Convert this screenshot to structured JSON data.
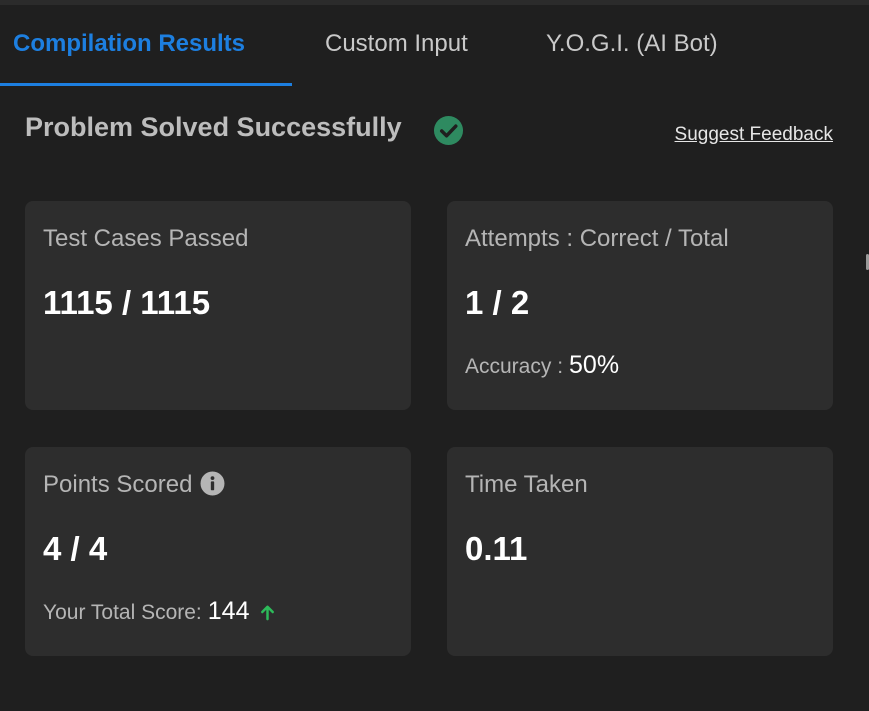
{
  "tabs": [
    {
      "label": "Compilation Results",
      "active": true
    },
    {
      "label": "Custom Input",
      "active": false
    },
    {
      "label": "Y.O.G.I. (AI Bot)",
      "active": false
    }
  ],
  "status": {
    "title": "Problem Solved Successfully",
    "icon": "check-circle-icon",
    "icon_color": "#2e8a60"
  },
  "feedback_link": "Suggest Feedback",
  "cards": {
    "test_cases": {
      "label": "Test Cases Passed",
      "value": "1115 / 1115"
    },
    "attempts": {
      "label": "Attempts : Correct / Total",
      "value": "1 / 2",
      "sub_label": "Accuracy :",
      "sub_value": "50%"
    },
    "points": {
      "label": "Points Scored",
      "value": "4 / 4",
      "sub_label": "Your Total Score:",
      "sub_value": "144",
      "trend_icon": "arrow-up-icon",
      "trend_color": "#2dbb5a"
    },
    "time": {
      "label": "Time Taken",
      "value": "0.11"
    }
  },
  "colors": {
    "accent": "#1d7fe0",
    "background": "#1f1f1f",
    "card": "#2d2d2d"
  }
}
